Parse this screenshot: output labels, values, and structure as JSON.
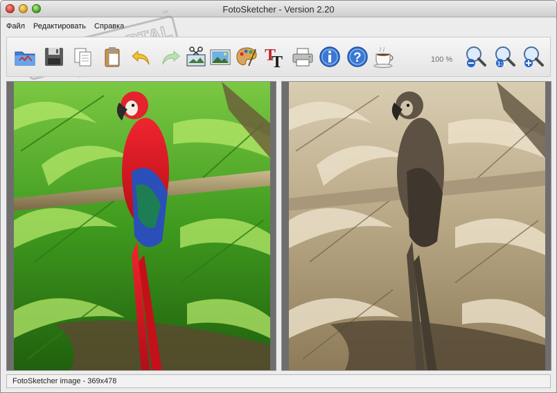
{
  "window": {
    "title": "FotoSketcher - Version 2.20"
  },
  "menu": {
    "items": [
      "Файл",
      "Редактировать",
      "Справка"
    ]
  },
  "watermark": {
    "text": "SOFTPORTAL",
    "sub": "www.softportal.com",
    "tm": "™"
  },
  "toolbar": {
    "buttons": [
      {
        "icon": "open-folder-icon"
      },
      {
        "icon": "save-icon"
      },
      {
        "icon": "copy-icon"
      },
      {
        "icon": "paste-icon"
      },
      {
        "icon": "undo-icon"
      },
      {
        "icon": "redo-icon"
      },
      {
        "icon": "crop-icon"
      },
      {
        "icon": "image-icon"
      },
      {
        "icon": "palette-icon"
      },
      {
        "icon": "text-icon"
      },
      {
        "icon": "print-icon"
      },
      {
        "icon": "info-icon"
      },
      {
        "icon": "help-icon"
      },
      {
        "icon": "coffee-icon"
      },
      {
        "icon": "zoom-out-icon"
      },
      {
        "icon": "zoom-actual-icon"
      },
      {
        "icon": "zoom-in-icon"
      }
    ],
    "zoom_level": "100 %"
  },
  "status": {
    "text": "FotoSketcher image - 369x478"
  },
  "colors": {
    "accent": "#1a6ad4",
    "parrot_red": "#d8141e",
    "sepia": "#a38f6e"
  }
}
